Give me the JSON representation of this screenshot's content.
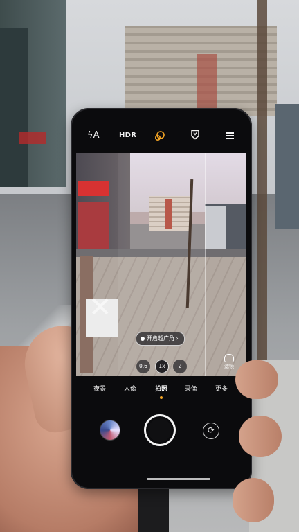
{
  "camera": {
    "top_bar": {
      "flash_icon": "flash-auto-icon",
      "flash_glyph": "ϟA",
      "hdr_label": "HDR",
      "beauty_icon": "beauty-face-icon",
      "film_icon": "film-mode-icon",
      "film_glyph": "🂠",
      "menu_icon": "hamburger-menu-icon"
    },
    "viewfinder": {
      "wide_angle_pill": "开启超广角",
      "wide_angle_chevron": "›",
      "zoom_levels": [
        "0.6",
        "1x",
        "2"
      ],
      "selected_zoom": "1x",
      "filter_label": "滤镜"
    },
    "modes": [
      {
        "label": "夜景"
      },
      {
        "label": "人像"
      },
      {
        "label": "拍照"
      },
      {
        "label": "录像"
      },
      {
        "label": "更多"
      }
    ],
    "active_mode": "拍照",
    "bottom": {
      "gallery_icon": "gallery-thumbnail",
      "shutter_icon": "shutter-button",
      "switch_icon": "camera-switch-icon",
      "switch_glyph": "⟳"
    },
    "accent_color": "#f5a524"
  }
}
